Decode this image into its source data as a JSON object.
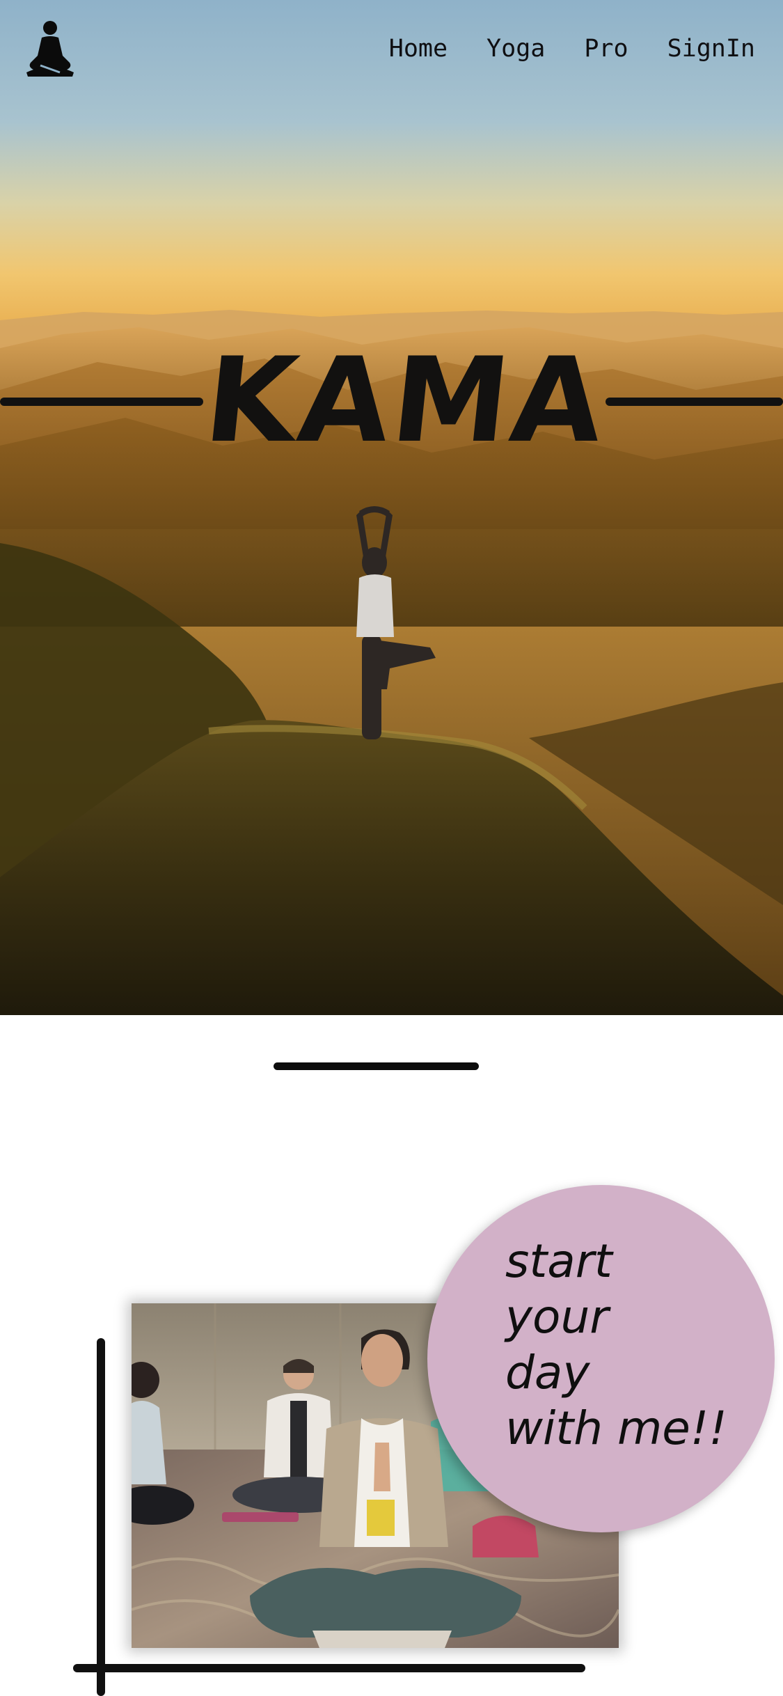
{
  "nav": {
    "logo_icon": "meditation-figure-icon",
    "links": [
      {
        "label": "Home"
      },
      {
        "label": "Yoga"
      },
      {
        "label": "Pro"
      },
      {
        "label": "SignIn"
      }
    ]
  },
  "hero": {
    "title": "KAMA",
    "image": "woman-doing-tree-pose-on-mountain-at-sunset"
  },
  "promo": {
    "lines": [
      "start",
      "your",
      "day",
      "with me!!"
    ],
    "image": "yoga-class-meditating-with-hands-in-prayer",
    "circle_color": "#d2b1c8"
  },
  "colors": {
    "sky_top": "#90b2c8",
    "horizon": "#e8b55a",
    "line_black": "#101010"
  }
}
